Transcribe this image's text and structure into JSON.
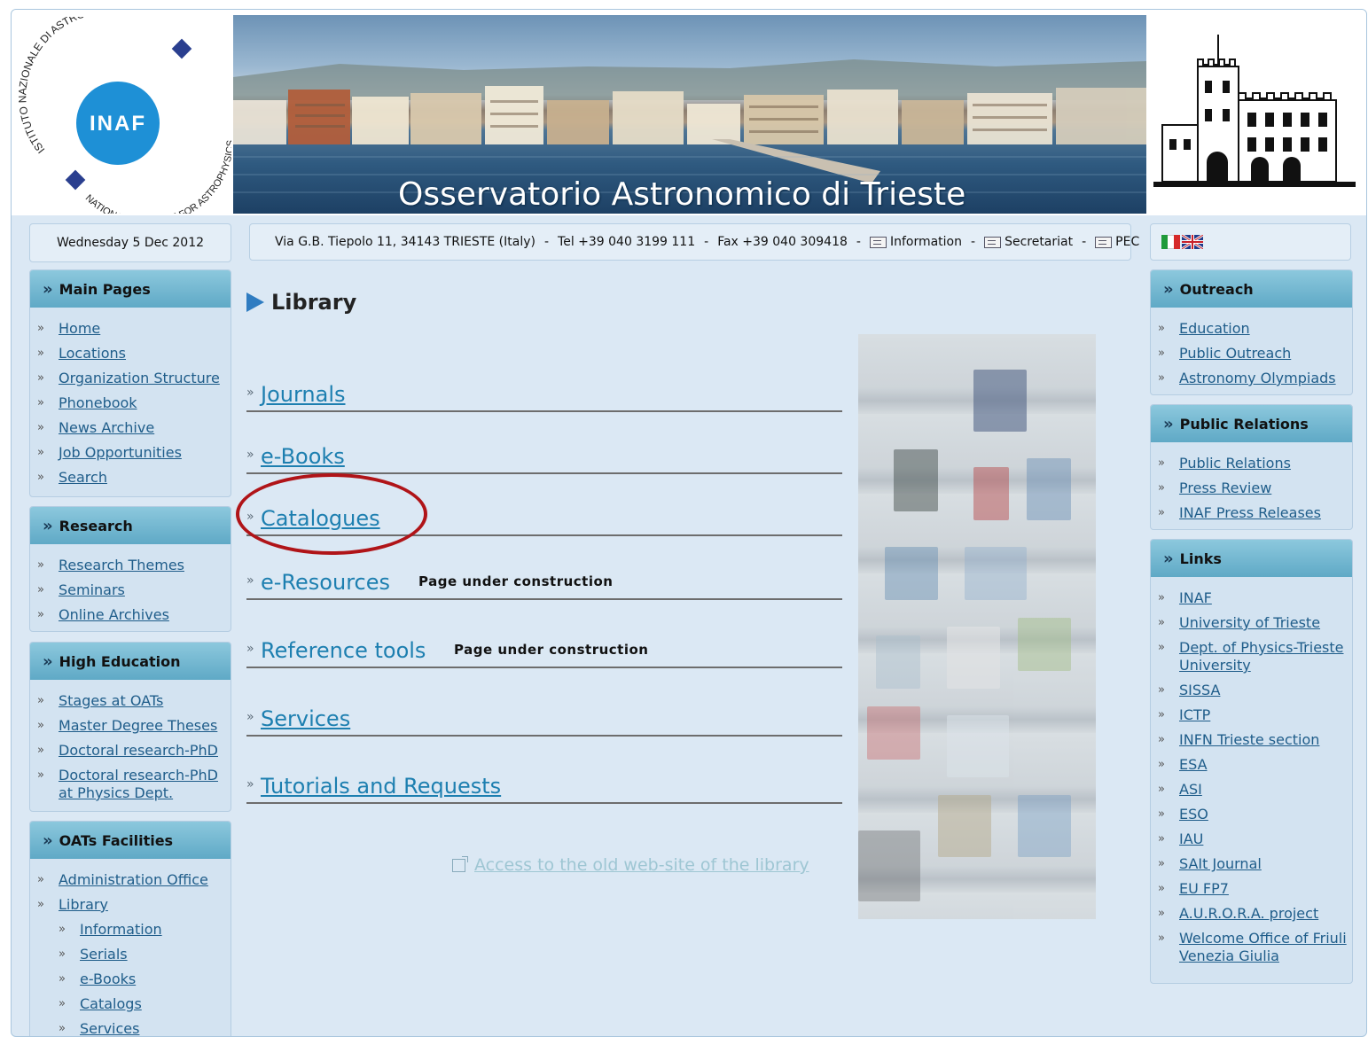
{
  "header": {
    "logo_text_top": "ISTITUTO NAZIONALE DI ASTROFISICA",
    "logo_text_bottom": "NATIONAL INSTITUTE FOR ASTROPHYSICS",
    "logo_center": "INAF",
    "banner_title": "Osservatorio Astronomico di Trieste"
  },
  "info_bar": {
    "date": "Wednesday 5 Dec 2012",
    "address": "Via G.B. Tiepolo 11, 34143 TRIESTE (Italy)",
    "tel": "Tel +39 040 3199 111",
    "fax": "Fax +39 040 309418",
    "information": "Information",
    "secretariat": "Secretariat",
    "pec": "PEC"
  },
  "left_sidebar": {
    "main_pages": {
      "title": "Main Pages",
      "items": [
        "Home",
        "Locations",
        "Organization Structure",
        "Phonebook",
        "News Archive",
        "Job Opportunities",
        "Search"
      ]
    },
    "research": {
      "title": "Research",
      "items": [
        "Research Themes",
        "Seminars",
        "Online Archives"
      ]
    },
    "high_education": {
      "title": "High Education",
      "items": [
        "Stages at OATs",
        "Master Degree Theses",
        "Doctoral research-PhD",
        "Doctoral research-PhD at Physics Dept."
      ]
    },
    "facilities": {
      "title": "OATs Facilities",
      "items": [
        "Administration Office",
        "Library"
      ],
      "sub_items": [
        "Information",
        "Serials",
        "e-Books",
        "Catalogs",
        "Services"
      ]
    }
  },
  "main": {
    "title": "Library",
    "links": [
      "Journals",
      "e-Books",
      "Catalogues",
      "e-Resources",
      "Reference tools",
      "Services",
      "Tutorials and Requests"
    ],
    "under_construction": "Page under construction",
    "old_site_link": "Access to the old web-site of the library"
  },
  "right_sidebar": {
    "outreach": {
      "title": "Outreach",
      "items": [
        "Education",
        "Public Outreach",
        "Astronomy Olympiads"
      ]
    },
    "public_relations": {
      "title": "Public Relations",
      "items": [
        "Public Relations",
        "Press Review",
        "INAF Press Releases"
      ]
    },
    "links": {
      "title": "Links",
      "items": [
        "INAF",
        "University of Trieste",
        "Dept. of Physics-Trieste University",
        "SISSA",
        "ICTP",
        "INFN Trieste section",
        "ESA",
        "ASI",
        "ESO",
        "IAU",
        "SAIt Journal",
        "EU FP7",
        "A.U.R.O.R.A. project",
        "Welcome Office of Friuli Venezia Giulia"
      ]
    }
  },
  "colors": {
    "link": "#1f5d8a",
    "main_link": "#1d7fb0",
    "box_header": "#6fb5cf",
    "background": "#dbe8f4",
    "highlight_circle": "#b01418"
  }
}
